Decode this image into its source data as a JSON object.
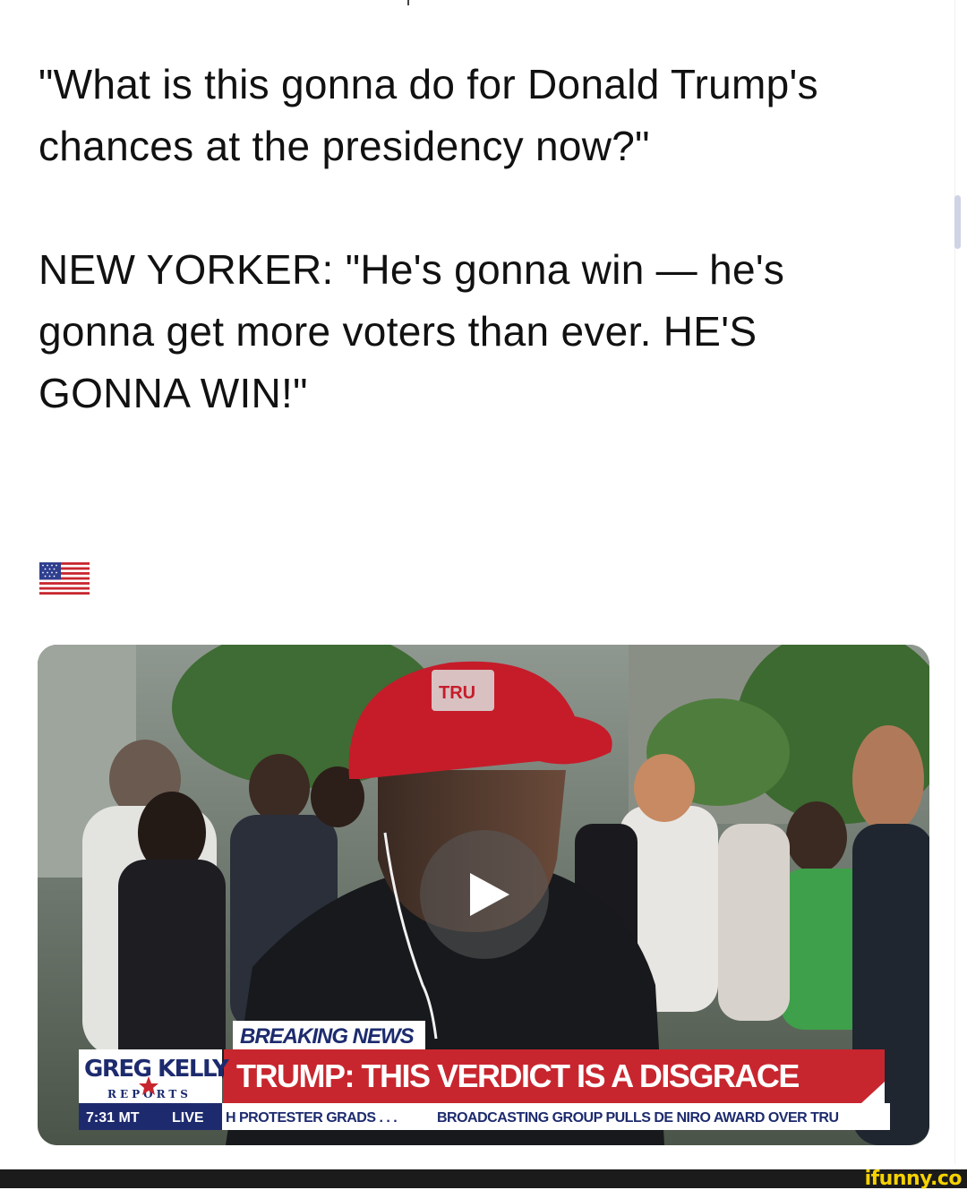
{
  "post": {
    "question": "\"What is this gonna do for Donald Trump's chances at the presidency now?\"",
    "answer": "NEW YORKER: \"He's gonna win — he's gonna get more voters than ever. HE'S GONNA WIN!\"",
    "emoji": "us-flag-icon"
  },
  "video": {
    "breaking_label": "BREAKING NEWS",
    "headline": "TRUMP: THIS VERDICT IS A DISGRACE",
    "show_logo": "GREG KELLY",
    "show_logo_sub": "REPORTS",
    "time": "7:31 MT",
    "live": "LIVE",
    "ticker_1": "H PROTESTER GRADS . . .",
    "ticker_2": "BROADCASTING GROUP PULLS DE NIRO AWARD OVER TRU",
    "hat_text": "TRU",
    "play_icon": "play-icon"
  },
  "watermark": "ifunny.co",
  "colors": {
    "hat_red": "#c61c2a",
    "banner_red": "#c8262f",
    "navy": "#1d2b6e",
    "watermark_yellow": "#f5d200"
  }
}
